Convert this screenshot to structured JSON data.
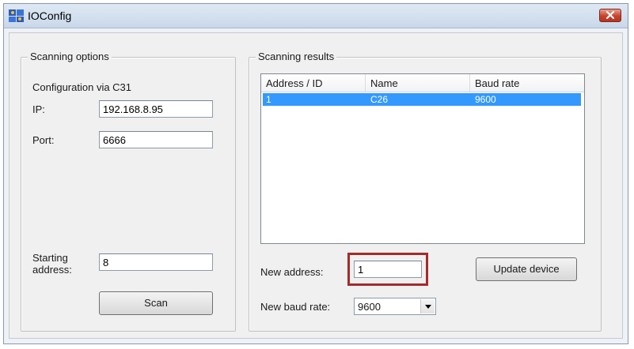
{
  "window": {
    "title": "IOConfig"
  },
  "options": {
    "legend": "Scanning options",
    "configuration_label": "Configuration via C31",
    "ip_label": "IP:",
    "ip_value": "192.168.8.95",
    "port_label": "Port:",
    "port_value": "6666",
    "starting_label_line1": "Starting",
    "starting_label_line2": "address:",
    "starting_value": "8",
    "scan_label": "Scan"
  },
  "results": {
    "legend": "Scanning results",
    "columns": [
      "Address / ID",
      "Name",
      "Baud rate"
    ],
    "rows": [
      {
        "address": "1",
        "name": "C26",
        "baud": "9600",
        "selected": true
      }
    ],
    "new_address_label": "New address:",
    "new_address_value": "1",
    "update_label": "Update device",
    "new_baud_label": "New baud rate:",
    "new_baud_value": "9600"
  },
  "colors": {
    "selection": "#3399ff",
    "highlight_border": "#a52a2a",
    "close_button": "#c7432c"
  },
  "icons": {
    "app": "app-icon",
    "close": "close-icon",
    "dropdown": "chevron-down-icon"
  }
}
